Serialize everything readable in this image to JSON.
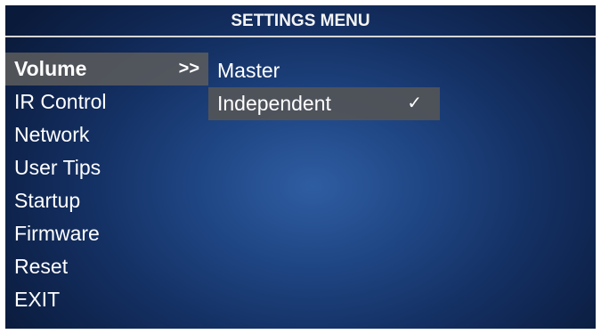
{
  "header": {
    "title": "SETTINGS MENU"
  },
  "main_menu": {
    "items": [
      {
        "label": "Volume",
        "arrow": ">>"
      },
      {
        "label": "IR Control"
      },
      {
        "label": "Network"
      },
      {
        "label": "User Tips"
      },
      {
        "label": "Startup"
      },
      {
        "label": "Firmware"
      },
      {
        "label": "Reset"
      },
      {
        "label": "EXIT"
      }
    ],
    "selected": "Volume"
  },
  "sub_menu": {
    "items": [
      {
        "label": "Master"
      },
      {
        "label": "Independent",
        "check": "✓"
      }
    ],
    "selected": "Independent"
  },
  "colors": {
    "background_center": "#2f5da2",
    "background_edge": "#0a1a3a",
    "highlight": "#5c5c5c",
    "text": "#ffffff"
  }
}
